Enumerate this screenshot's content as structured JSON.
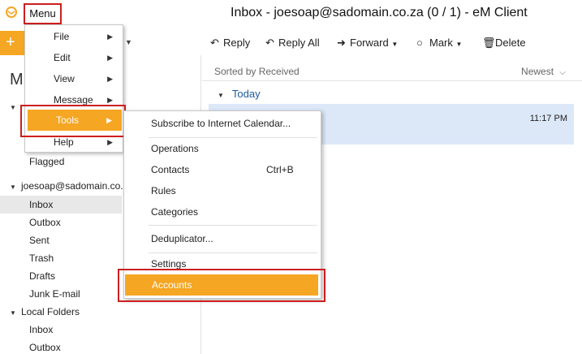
{
  "window": {
    "title": "Inbox - joesoap@sadomain.co.za (0 / 1) - eM Client",
    "menu_button": "Menu"
  },
  "sidebar": {
    "heading": "M",
    "flagged": "Flagged",
    "account": "joesoap@sadomain.co...",
    "account_folders": [
      "Inbox",
      "Outbox",
      "Sent",
      "Trash",
      "Drafts",
      "Junk E-mail"
    ],
    "local_group": "Local Folders",
    "local_folders": [
      "Inbox",
      "Outbox"
    ]
  },
  "toolbar": {
    "new_icon": "plus-icon",
    "reply": "Reply",
    "reply_all": "Reply All",
    "forward": "Forward",
    "mark": "Mark",
    "delete": "Delete"
  },
  "message_list": {
    "sorted_by": "Sorted by Received",
    "sort_order": "Newest",
    "group_label": "Today",
    "row_time": "11:17 PM"
  },
  "main_menu": {
    "items": [
      {
        "label": "File"
      },
      {
        "label": "Edit"
      },
      {
        "label": "View"
      },
      {
        "label": "Message"
      },
      {
        "label": "Tools"
      },
      {
        "label": "Help"
      }
    ]
  },
  "tools_submenu": {
    "subscribe": "Subscribe to Internet Calendar...",
    "operations": "Operations",
    "contacts": "Contacts",
    "contacts_shortcut": "Ctrl+B",
    "rules": "Rules",
    "categories": "Categories",
    "deduplicator": "Deduplicator...",
    "settings": "Settings",
    "accounts": "Accounts"
  },
  "colors": {
    "accent_orange": "#f5a623",
    "highlight_red": "#cc1f1f",
    "selected_row_blue": "#dce8f8",
    "group_blue": "#1e5a9e"
  }
}
